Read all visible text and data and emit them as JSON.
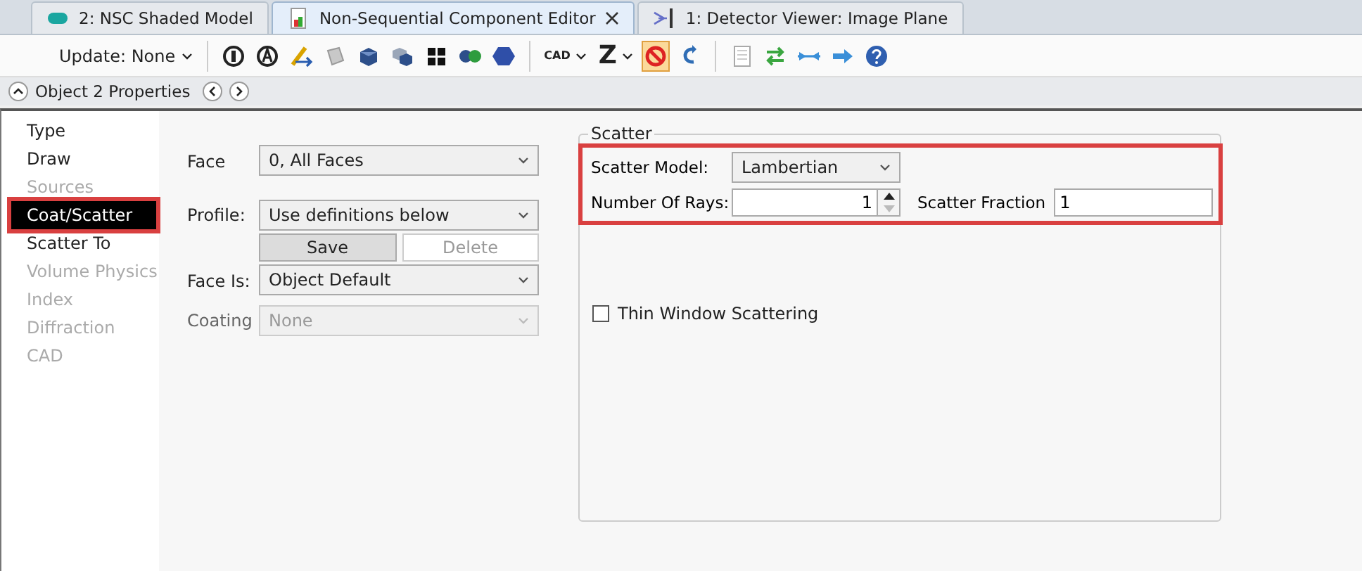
{
  "tabs": [
    {
      "label": "2: NSC Shaded Model",
      "kind": "model",
      "selected": false
    },
    {
      "label": "Non-Sequential Component Editor",
      "kind": "editor",
      "selected": true
    },
    {
      "label": "1: Detector Viewer: Image Plane",
      "kind": "viewer",
      "selected": false
    }
  ],
  "toolbar": {
    "update": "Update: None",
    "cad": "CAD",
    "z": "Z",
    "ignore_pressed": true
  },
  "properties_header": {
    "title": "Object 2 Properties"
  },
  "sidebar": {
    "items": [
      {
        "label": "Type",
        "disabled": false,
        "selected": false
      },
      {
        "label": "Draw",
        "disabled": false,
        "selected": false
      },
      {
        "label": "Sources",
        "disabled": true,
        "selected": false
      },
      {
        "label": "Coat/Scatter",
        "disabled": false,
        "selected": true
      },
      {
        "label": "Scatter To",
        "disabled": false,
        "selected": false
      },
      {
        "label": "Volume Physics",
        "disabled": true,
        "selected": false
      },
      {
        "label": "Index",
        "disabled": true,
        "selected": false
      },
      {
        "label": "Diffraction",
        "disabled": true,
        "selected": false
      },
      {
        "label": "CAD",
        "disabled": true,
        "selected": false
      }
    ]
  },
  "form": {
    "face": {
      "label": "Face",
      "value": "0, All Faces",
      "disabled": false
    },
    "profile": {
      "label": "Profile:",
      "value": "Use definitions below",
      "disabled": false
    },
    "buttons": [
      {
        "label": "Save",
        "disabled": false
      },
      {
        "label": "Delete",
        "disabled": true
      }
    ],
    "face_is": {
      "label": "Face Is:",
      "value": "Object Default",
      "disabled": false
    },
    "coating": {
      "label": "Coating",
      "value": "None",
      "disabled": true
    }
  },
  "scatter": {
    "title": "Scatter",
    "highlighted": true,
    "model": {
      "label": "Scatter Model:",
      "value": "Lambertian"
    },
    "rays": {
      "label": "Number Of Rays:",
      "value": "1"
    },
    "fraction": {
      "label": "Scatter Fraction",
      "value": "1"
    },
    "thin_window": {
      "label": "Thin Window Scattering",
      "checked": false
    }
  }
}
